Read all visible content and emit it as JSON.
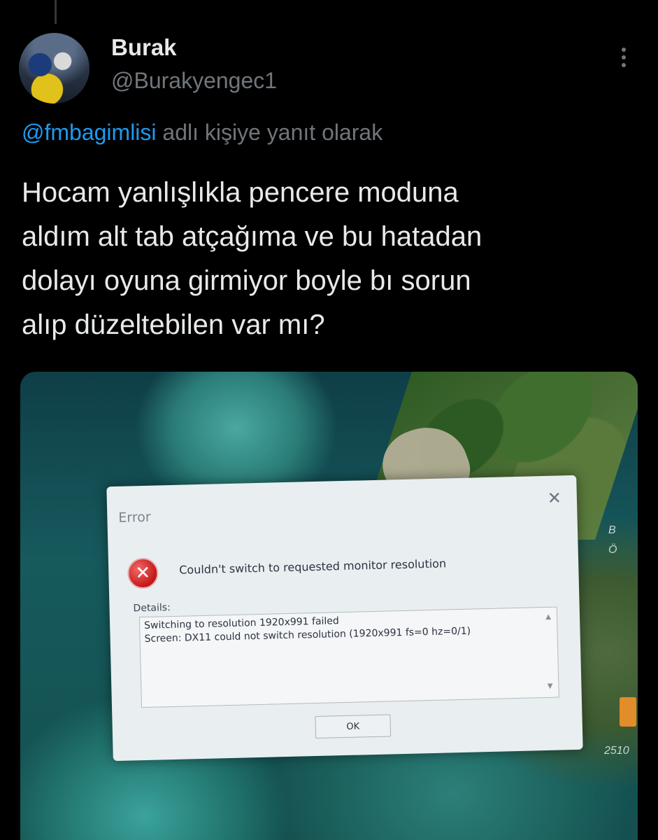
{
  "author": {
    "name": "Burak",
    "handle": "@Burakyengec1"
  },
  "reply_context": {
    "mention": "@fmbagimlisi",
    "suffix": " adlı kişiye yanıt olarak"
  },
  "tweet": {
    "lines": [
      "Hocam yanlışlıkla pencere moduna",
      "aldım alt tab atçağıma ve bu hatadan",
      "dolayı oyuna girmiyor boyle bı sorun",
      "alıp düzeltebilen var mı?"
    ]
  },
  "photo": {
    "side_labels": [
      "B",
      "Ö",
      "2510"
    ],
    "dialog": {
      "title": "Error",
      "close": "✕",
      "message": "Couldn't switch to requested monitor resolution",
      "details_label": "Details:",
      "details_lines": [
        "Switching to resolution 1920x991 failed",
        "Screen: DX11 could not switch resolution (1920x991 fs=0 hz=0/1)"
      ],
      "ok_label": "OK"
    }
  },
  "icons": {
    "more": "more-vertical-icon",
    "error": "error-x-icon"
  },
  "colors": {
    "background": "#000000",
    "text": "#e7e9ea",
    "muted": "#71767b",
    "link": "#1d9bf0"
  }
}
